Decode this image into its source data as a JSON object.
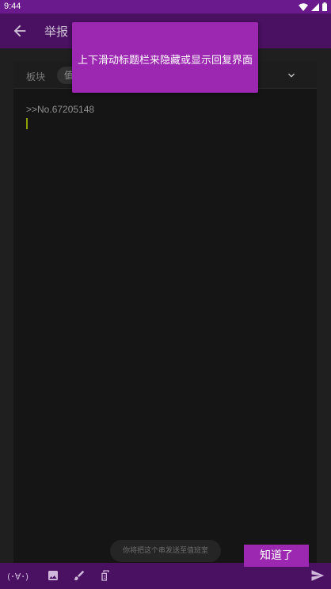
{
  "status_bar": {
    "time": "9:44",
    "icons": [
      "wifi-icon",
      "signal-icon",
      "battery-icon"
    ]
  },
  "app_bar": {
    "back_icon": "arrow-left-icon",
    "title": "举报"
  },
  "reply": {
    "board_label": "板块",
    "board_value": "值",
    "dropdown_icon": "chevron-down-icon",
    "content": ">>No.67205148"
  },
  "toast": {
    "text": "你将把这个串发送至值班室"
  },
  "toolbar": {
    "kaomoji_label": "(･∀･)",
    "icons": [
      "image-icon",
      "brush-icon",
      "dice-icon"
    ],
    "send_icon": "send-icon"
  },
  "tip": {
    "text": "上下滑动标题栏来隐藏或显示回复界面",
    "confirm_label": "知道了"
  },
  "colors": {
    "accent": "#9c27b0",
    "status_bar": "#6a1a8c",
    "dimmed_bar": "#4a1062"
  }
}
